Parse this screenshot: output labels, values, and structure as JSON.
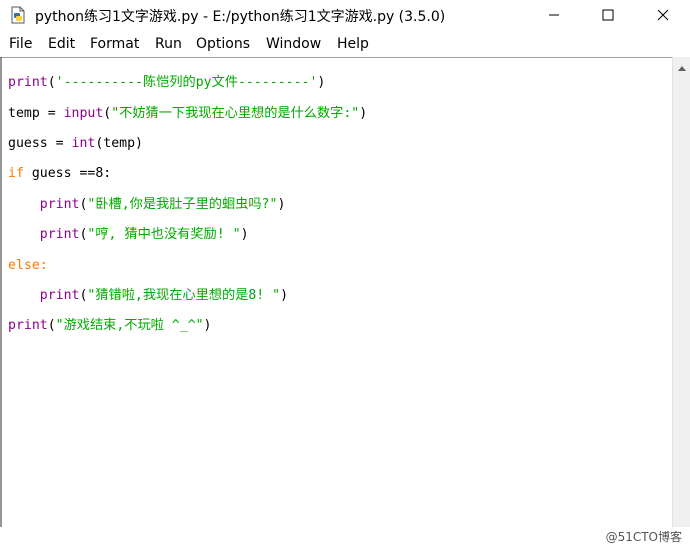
{
  "window": {
    "title": "python练习1文字游戏.py - E:/python练习1文字游戏.py (3.5.0)",
    "icon": "python-file-icon"
  },
  "window_controls": {
    "minimize": "minimize-icon",
    "maximize": "maximize-icon",
    "close": "close-icon"
  },
  "menu": {
    "file": "File",
    "edit": "Edit",
    "format": "Format",
    "run": "Run",
    "options": "Options",
    "window": "Window",
    "help": "Help"
  },
  "code": {
    "l1_print": "print",
    "l1_open": "(",
    "l1_str": "'----------陈恺列的py文件---------'",
    "l1_close": ")",
    "l2_var": "temp = ",
    "l2_input": "input",
    "l2_open": "(",
    "l2_str": "\"不妨猜一下我现在心里想的是什么数字:\"",
    "l2_close": ")",
    "l3_var": "guess = ",
    "l3_int": "int",
    "l3_rest": "(temp)",
    "l4_if": "if",
    "l4_rest": " guess ==8:",
    "l5_indent": "    ",
    "l5_print": "print",
    "l5_open": "(",
    "l5_str": "\"卧槽,你是我肚子里的蛔虫吗?\"",
    "l5_close": ")",
    "l6_indent": "    ",
    "l6_print": "print",
    "l6_open": "(",
    "l6_str": "\"哼, 猜中也没有奖励! \"",
    "l6_close": ")",
    "l7_else": "else:",
    "l8_indent": "    ",
    "l8_print": "print",
    "l8_open": "(",
    "l8_str": "\"猜错啦,我现在心里想的是8! \"",
    "l8_close": ")",
    "l9_print": "print",
    "l9_open": "(",
    "l9_str": "\"游戏结束,不玩啦 ^_^\"",
    "l9_close": ")"
  },
  "watermark": "@51CTO博客",
  "colors": {
    "keyword": "#ff7700",
    "builtin": "#900090",
    "string": "#00aa00",
    "text": "#000000"
  }
}
